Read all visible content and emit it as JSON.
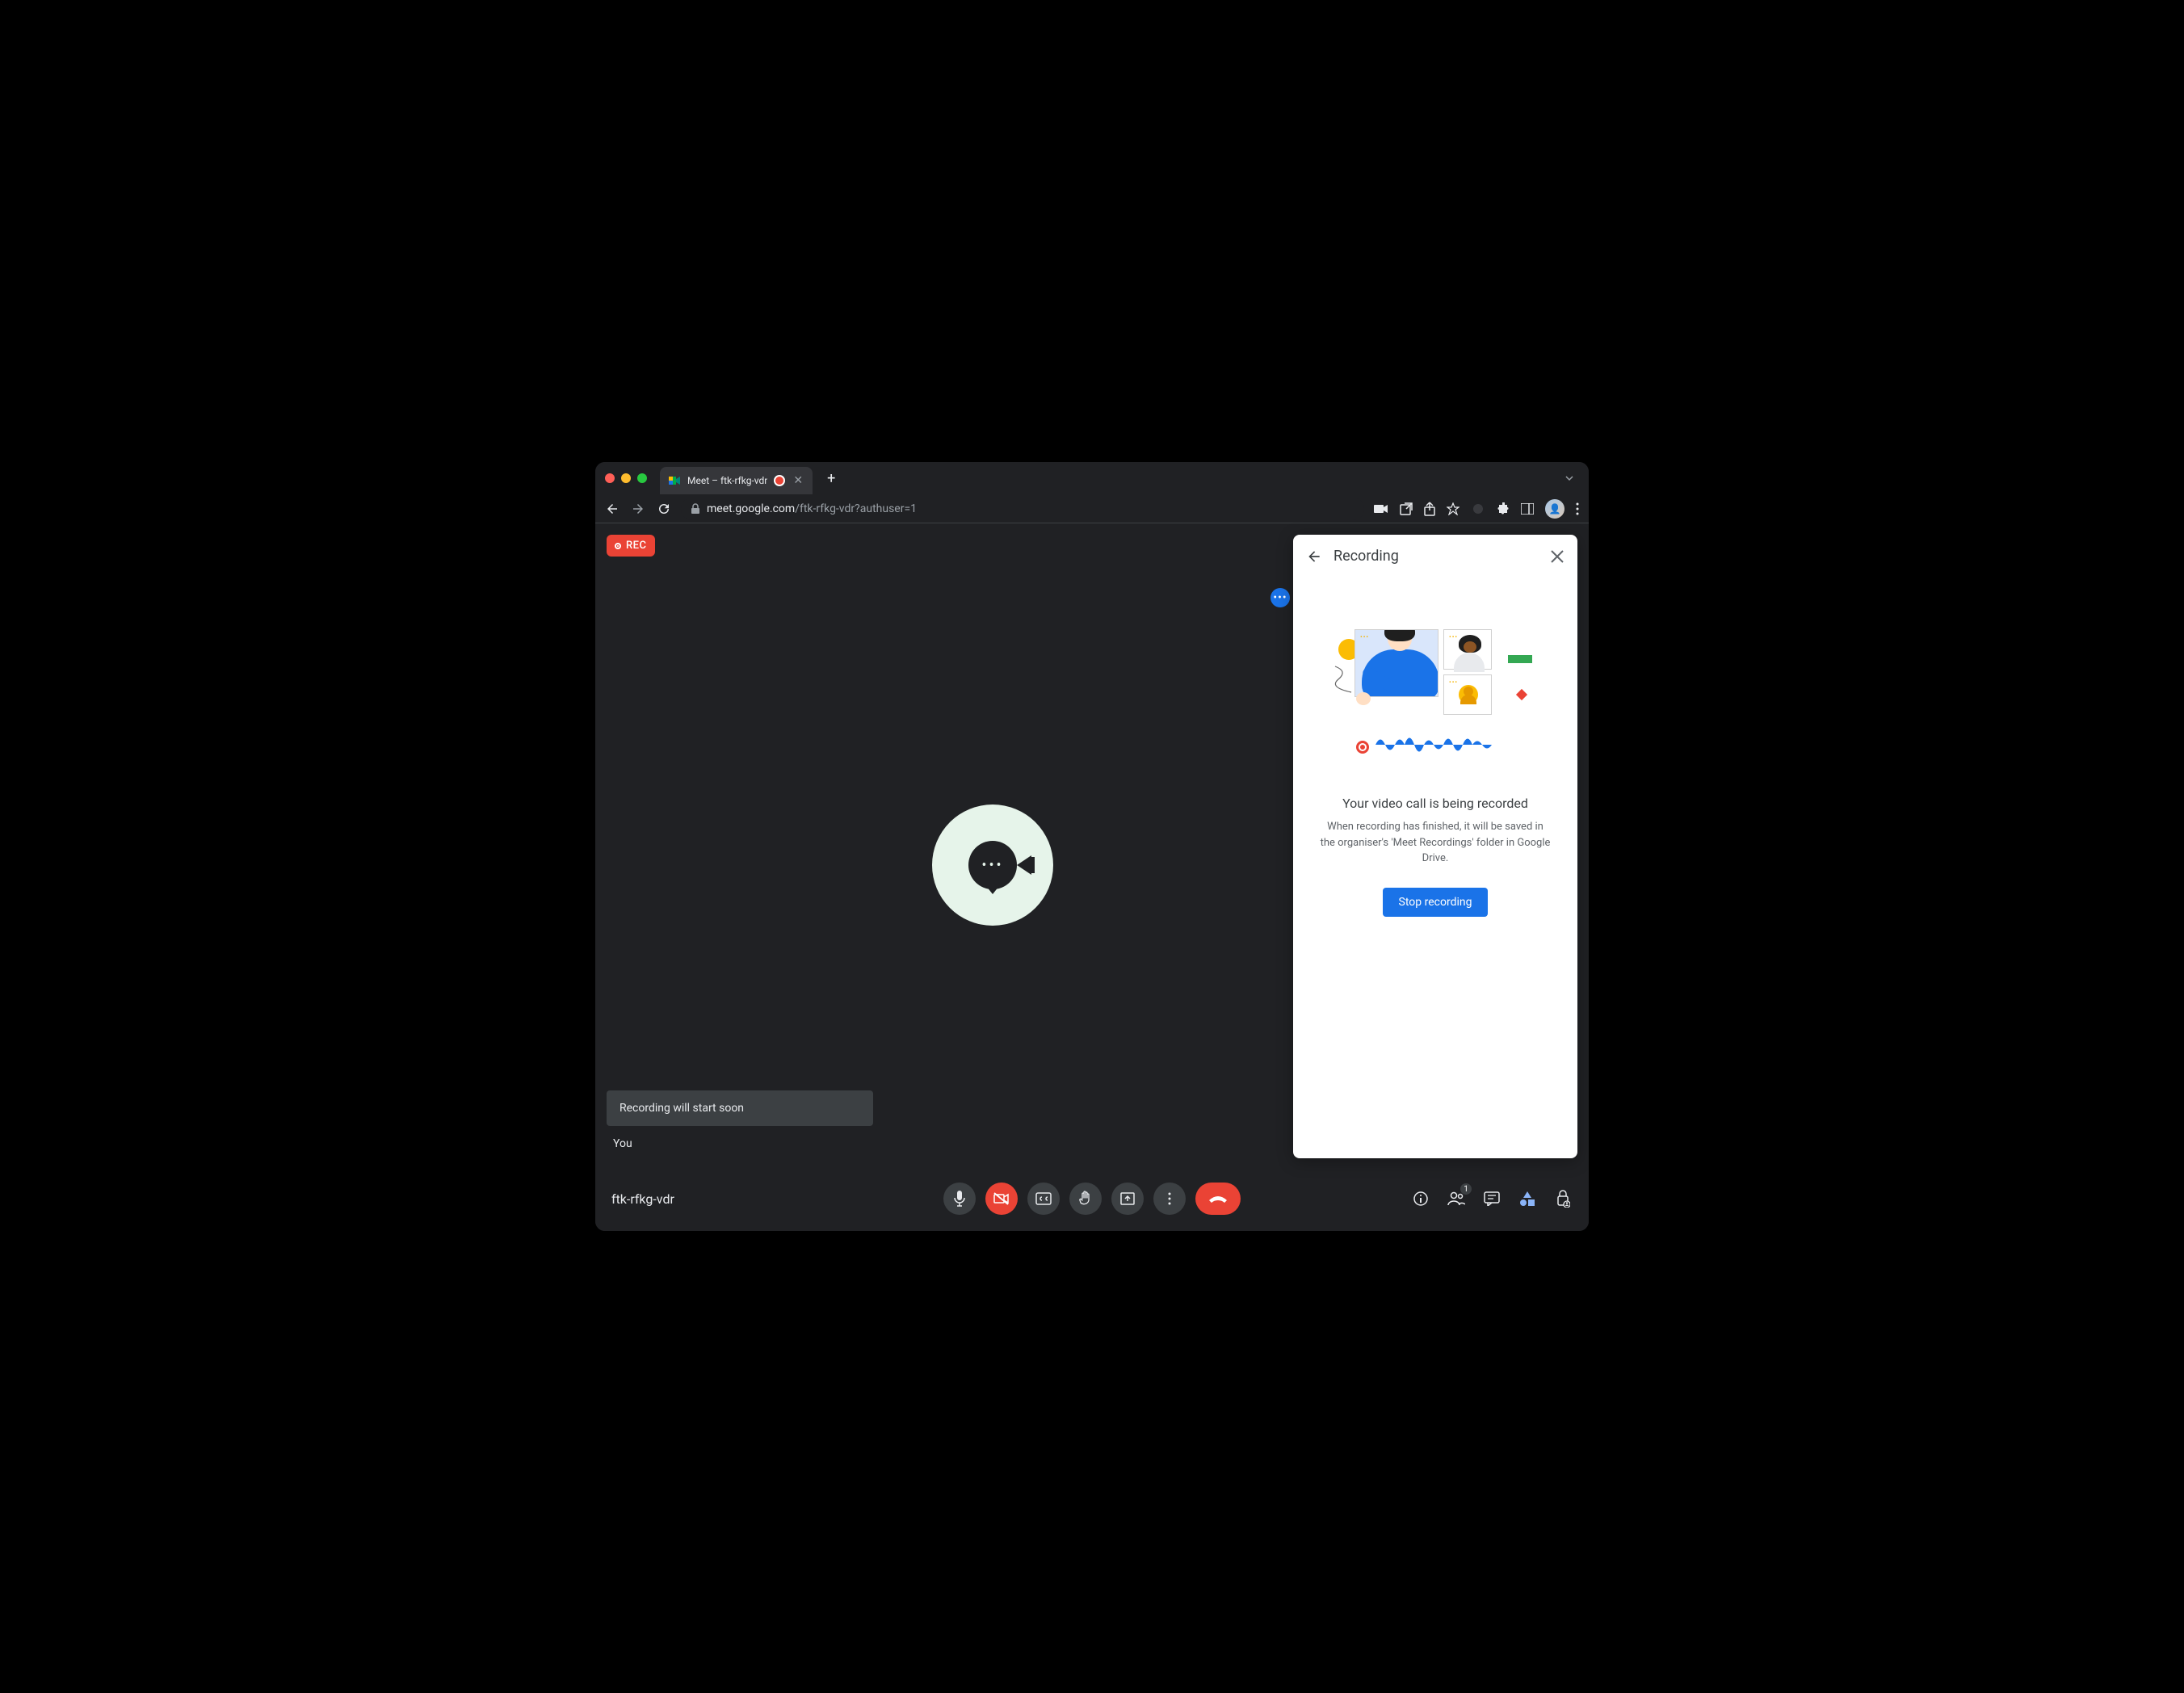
{
  "browser": {
    "tab_title": "Meet – ftk-rfkg-vdr",
    "url_host": "meet.google.com",
    "url_path": "/ftk-rfkg-vdr?authuser=1"
  },
  "rec_badge": "REC",
  "toast": "Recording will start soon",
  "self_label": "You",
  "meeting_code": "ftk-rfkg-vdr",
  "participants_count": "1",
  "panel": {
    "title": "Recording",
    "heading": "Your video call is being recorded",
    "description": "When recording has finished, it will be saved in the organiser's 'Meet Recordings' folder in Google Drive.",
    "stop_label": "Stop recording"
  }
}
